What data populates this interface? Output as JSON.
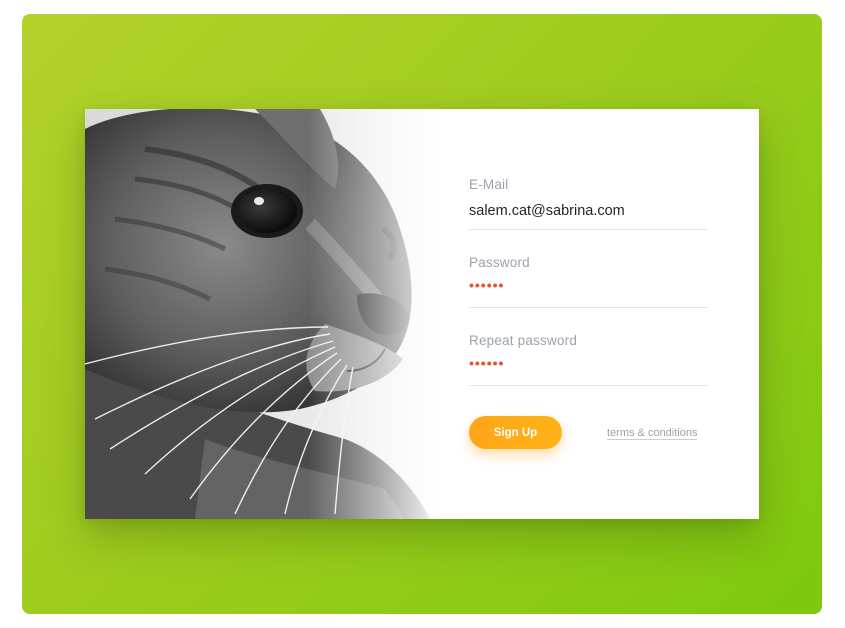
{
  "form": {
    "email": {
      "label": "E-Mail",
      "value": "salem.cat@sabrina.com"
    },
    "password": {
      "label": "Password",
      "masked_value": "••••••"
    },
    "repeat_password": {
      "label": "Repeat password",
      "masked_value": "••••••"
    },
    "signup_label": "Sign Up",
    "terms_link": "terms & conditions"
  },
  "colors": {
    "background_gradient_start": "#b3d12a",
    "background_gradient_end": "#7ec80f",
    "button": "#ffa418",
    "password_dots": "#e8542a",
    "label": "#9aa3ad"
  },
  "image": {
    "subject": "black-and-white cat portrait"
  }
}
